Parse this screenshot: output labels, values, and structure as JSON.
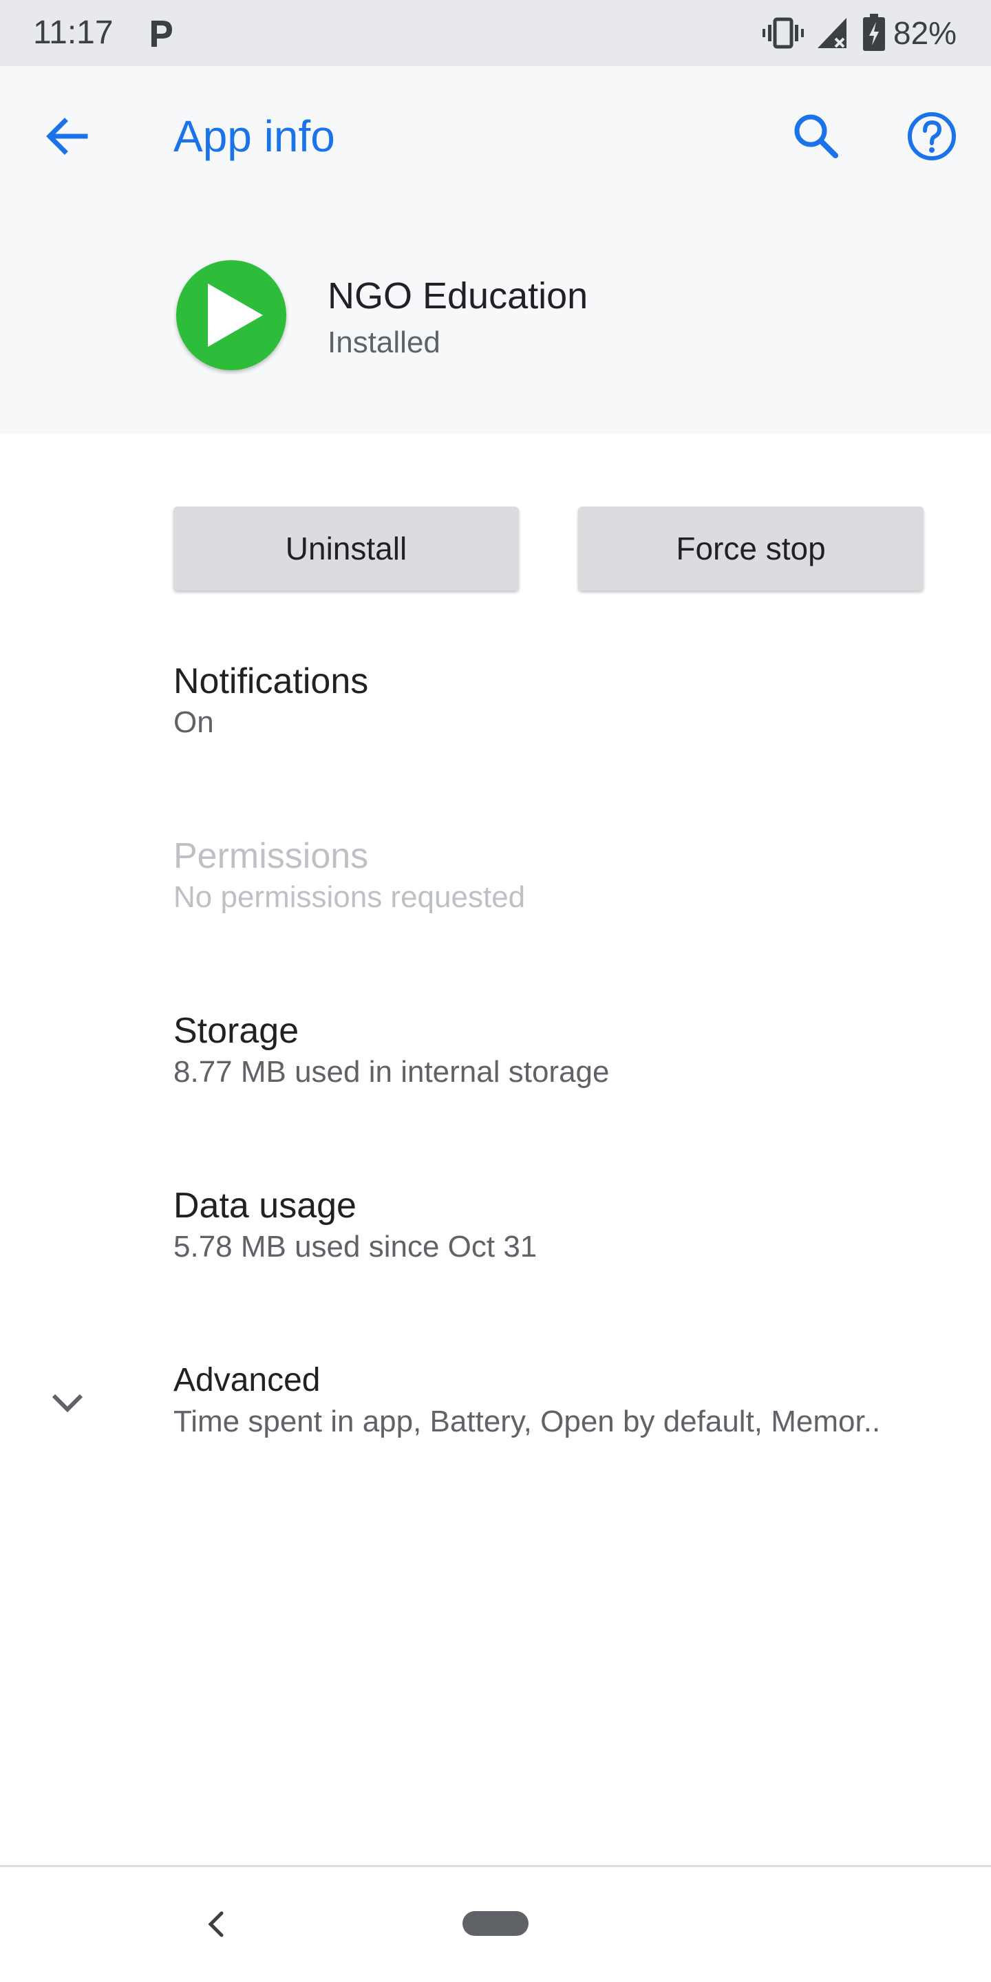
{
  "status_bar": {
    "time": "11:17",
    "battery_text": "82%",
    "icons": [
      "p-icon",
      "vibrate-icon",
      "signal-icon",
      "battery-icon"
    ]
  },
  "header": {
    "title": "App info",
    "icons": [
      "back-arrow-icon",
      "search-icon",
      "help-icon"
    ]
  },
  "app": {
    "name": "NGO Education",
    "status": "Installed",
    "icon": "play-icon"
  },
  "buttons": {
    "uninstall": "Uninstall",
    "force_stop": "Force stop"
  },
  "items": {
    "notifications": {
      "title": "Notifications",
      "subtitle": "On"
    },
    "permissions": {
      "title": "Permissions",
      "subtitle": "No permissions requested"
    },
    "storage": {
      "title": "Storage",
      "subtitle": "8.77 MB used in internal storage"
    },
    "data_usage": {
      "title": "Data usage",
      "subtitle": "5.78 MB used since Oct 31"
    },
    "advanced": {
      "title": "Advanced",
      "subtitle": "Time spent in app, Battery, Open by default, Memor.."
    }
  },
  "nav": {
    "icons": [
      "nav-back-icon",
      "home-pill-icon"
    ]
  },
  "colors": {
    "accent": "#1a73e8",
    "app_icon_green": "#2ebd3a",
    "header_bg": "#f7f8fa",
    "status_bar_bg": "#e8e9ec"
  }
}
